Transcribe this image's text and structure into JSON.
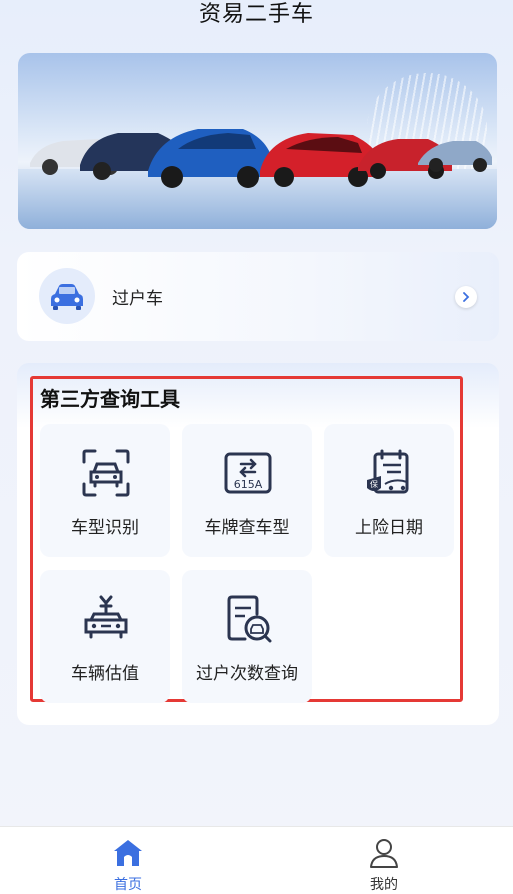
{
  "app": {
    "title": "资易二手车"
  },
  "transfer_card": {
    "label": "过户车",
    "icon": "car-icon"
  },
  "tools": {
    "title": "第三方查询工具",
    "items": [
      {
        "label": "车型识别",
        "icon": "car-scan-icon"
      },
      {
        "label": "车牌查车型",
        "icon": "license-plate-icon",
        "plate_text": "615A"
      },
      {
        "label": "上险日期",
        "icon": "insurance-calendar-icon",
        "badge": "保"
      },
      {
        "label": "车辆估值",
        "icon": "car-valuation-icon"
      },
      {
        "label": "过户次数查询",
        "icon": "transfer-document-icon"
      }
    ]
  },
  "tabbar": {
    "items": [
      {
        "label": "首页",
        "icon": "home-icon",
        "active": true
      },
      {
        "label": "我的",
        "icon": "user-icon",
        "active": false
      }
    ]
  },
  "colors": {
    "accent": "#3b6fe0",
    "highlight": "#e53935",
    "icon_dark": "#2b3550"
  }
}
